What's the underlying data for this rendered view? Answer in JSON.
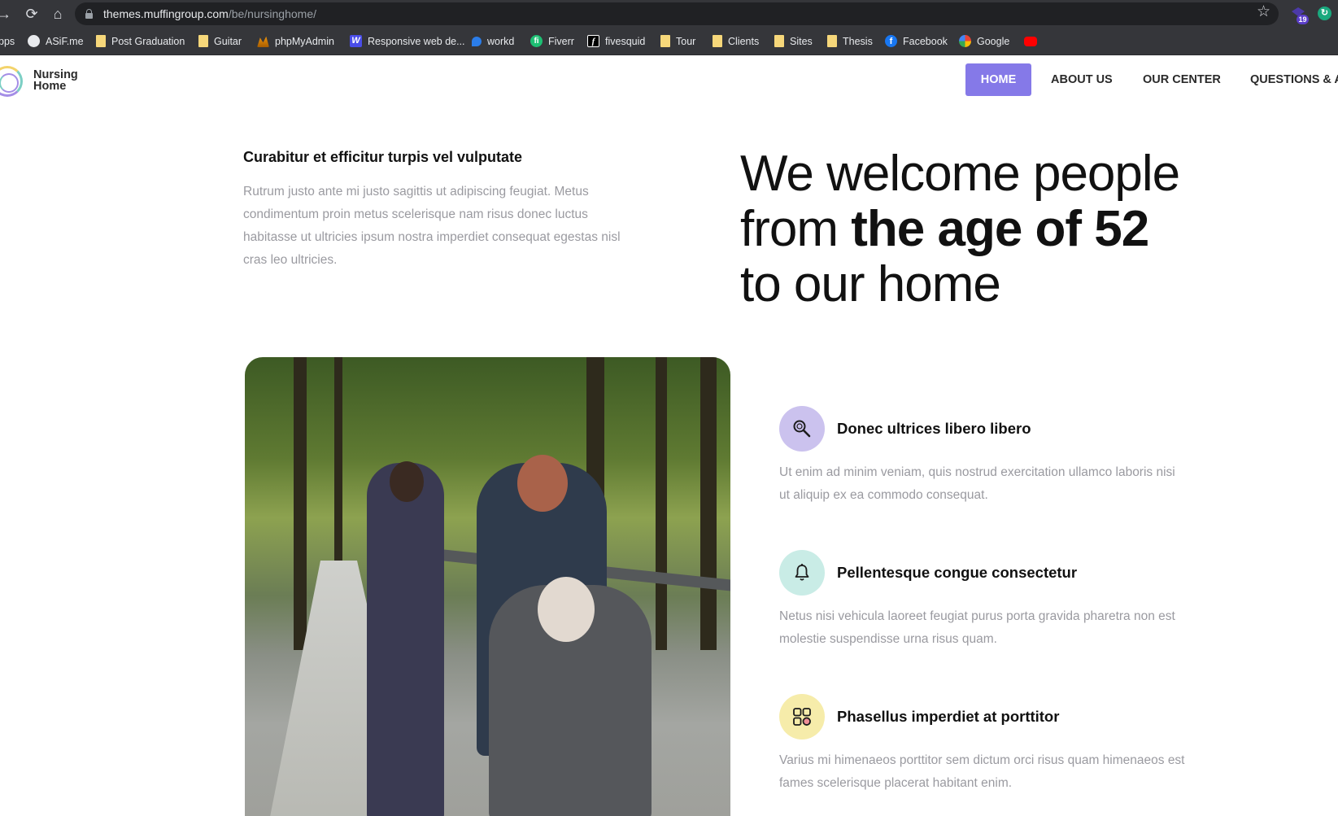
{
  "browser": {
    "url_host": "themes.muffingroup.com",
    "url_path": "/be/nursinghome/",
    "extension_badge": "19",
    "bookmarks": [
      {
        "label": "pps",
        "icon": "apps-icon"
      },
      {
        "label": "ASiF.me",
        "icon": "globe-icon"
      },
      {
        "label": "Post Graduation",
        "icon": "folder-icon"
      },
      {
        "label": "Guitar",
        "icon": "folder-icon"
      },
      {
        "label": "phpMyAdmin",
        "icon": "phpmyadmin-icon"
      },
      {
        "label": "Responsive web de...",
        "icon": "w-icon"
      },
      {
        "label": "workd",
        "icon": "workd-icon"
      },
      {
        "label": "Fiverr",
        "icon": "fiverr-icon"
      },
      {
        "label": "fivesquid",
        "icon": "fivesquid-icon"
      },
      {
        "label": "Tour",
        "icon": "folder-icon"
      },
      {
        "label": "Clients",
        "icon": "folder-icon"
      },
      {
        "label": "Sites",
        "icon": "folder-icon"
      },
      {
        "label": "Thesis",
        "icon": "folder-icon"
      },
      {
        "label": "Facebook",
        "icon": "facebook-icon"
      },
      {
        "label": "Google",
        "icon": "google-icon"
      },
      {
        "label": "",
        "icon": "youtube-icon"
      }
    ]
  },
  "site": {
    "logo_line1": "Nursing",
    "logo_line2": "Home",
    "nav": [
      {
        "label": "HOME",
        "active": true
      },
      {
        "label": "ABOUT US",
        "active": false
      },
      {
        "label": "OUR CENTER",
        "active": false
      },
      {
        "label": "QUESTIONS & AI",
        "active": false
      }
    ],
    "accent_color": "#8579e8"
  },
  "intro": {
    "heading": "Curabitur et efficitur turpis vel vulputate",
    "text": "Rutrum justo ante mi justo sagittis ut adipiscing feugiat. Metus condimentum proin metus scelerisque nam risus donec luctus habitasse ut ultricies ipsum nostra imperdiet consequat egestas nisl cras leo ultricies."
  },
  "hero": {
    "line1": "We welcome people",
    "line2_prefix": "from ",
    "line2_bold": "the age of 52",
    "line3": "to our home"
  },
  "features": [
    {
      "title": "Donec ultrices libero libero",
      "text": "Ut enim ad minim veniam, quis nostrud exercitation ullamco laboris nisi ut aliquip ex ea commodo consequat.",
      "icon": "search-icon",
      "color": "#cbc2ee"
    },
    {
      "title": "Pellentesque congue consectetur",
      "text": "Netus nisi vehicula laoreet feugiat purus porta gravida pharetra non est molestie suspendisse urna risus quam.",
      "icon": "bell-icon",
      "color": "#c9ece6"
    },
    {
      "title": "Phasellus imperdiet at porttitor",
      "text": "Varius mi himenaeos porttitor sem dictum orci risus quam himenaeos est fames scelerisque placerat habitant enim.",
      "icon": "grid-icon",
      "color": "#f6ecaa"
    }
  ]
}
